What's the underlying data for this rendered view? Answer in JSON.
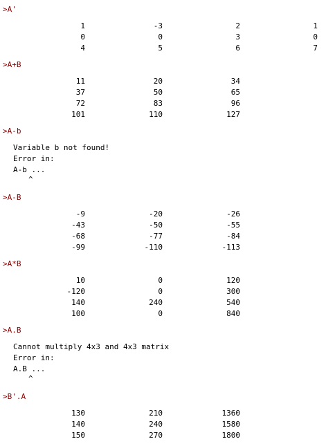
{
  "colors": {
    "background": "#ffffff",
    "prompt": "#8b0000",
    "output": "#000000"
  },
  "session": [
    {
      "prompt": ">A'",
      "matrix": [
        [
          "1",
          "-3",
          "2",
          "1"
        ],
        [
          "0",
          "0",
          "3",
          "0"
        ],
        [
          "4",
          "5",
          "6",
          "7"
        ]
      ]
    },
    {
      "prompt": ">A+B",
      "matrix": [
        [
          "11",
          "20",
          "34"
        ],
        [
          "37",
          "50",
          "65"
        ],
        [
          "72",
          "83",
          "96"
        ],
        [
          "101",
          "110",
          "127"
        ]
      ]
    },
    {
      "prompt": ">A-b",
      "message": [
        "Variable b not found!",
        "Error in:",
        "A-b ..."
      ],
      "caret": "^"
    },
    {
      "prompt": ">A-B",
      "matrix": [
        [
          "-9",
          "-20",
          "-26"
        ],
        [
          "-43",
          "-50",
          "-55"
        ],
        [
          "-68",
          "-77",
          "-84"
        ],
        [
          "-99",
          "-110",
          "-113"
        ]
      ]
    },
    {
      "prompt": ">A*B",
      "matrix": [
        [
          "10",
          "0",
          "120"
        ],
        [
          "-120",
          "0",
          "300"
        ],
        [
          "140",
          "240",
          "540"
        ],
        [
          "100",
          "0",
          "840"
        ]
      ]
    },
    {
      "prompt": ">A.B",
      "message": [
        "Cannot multiply 4x3 and 4x3 matrix",
        "Error in:",
        "A.B ..."
      ],
      "caret": "^"
    },
    {
      "prompt": ">B'.A",
      "matrix": [
        [
          "130",
          "210",
          "1360"
        ],
        [
          "140",
          "240",
          "1580"
        ],
        [
          "150",
          "270",
          "1800"
        ]
      ]
    }
  ]
}
